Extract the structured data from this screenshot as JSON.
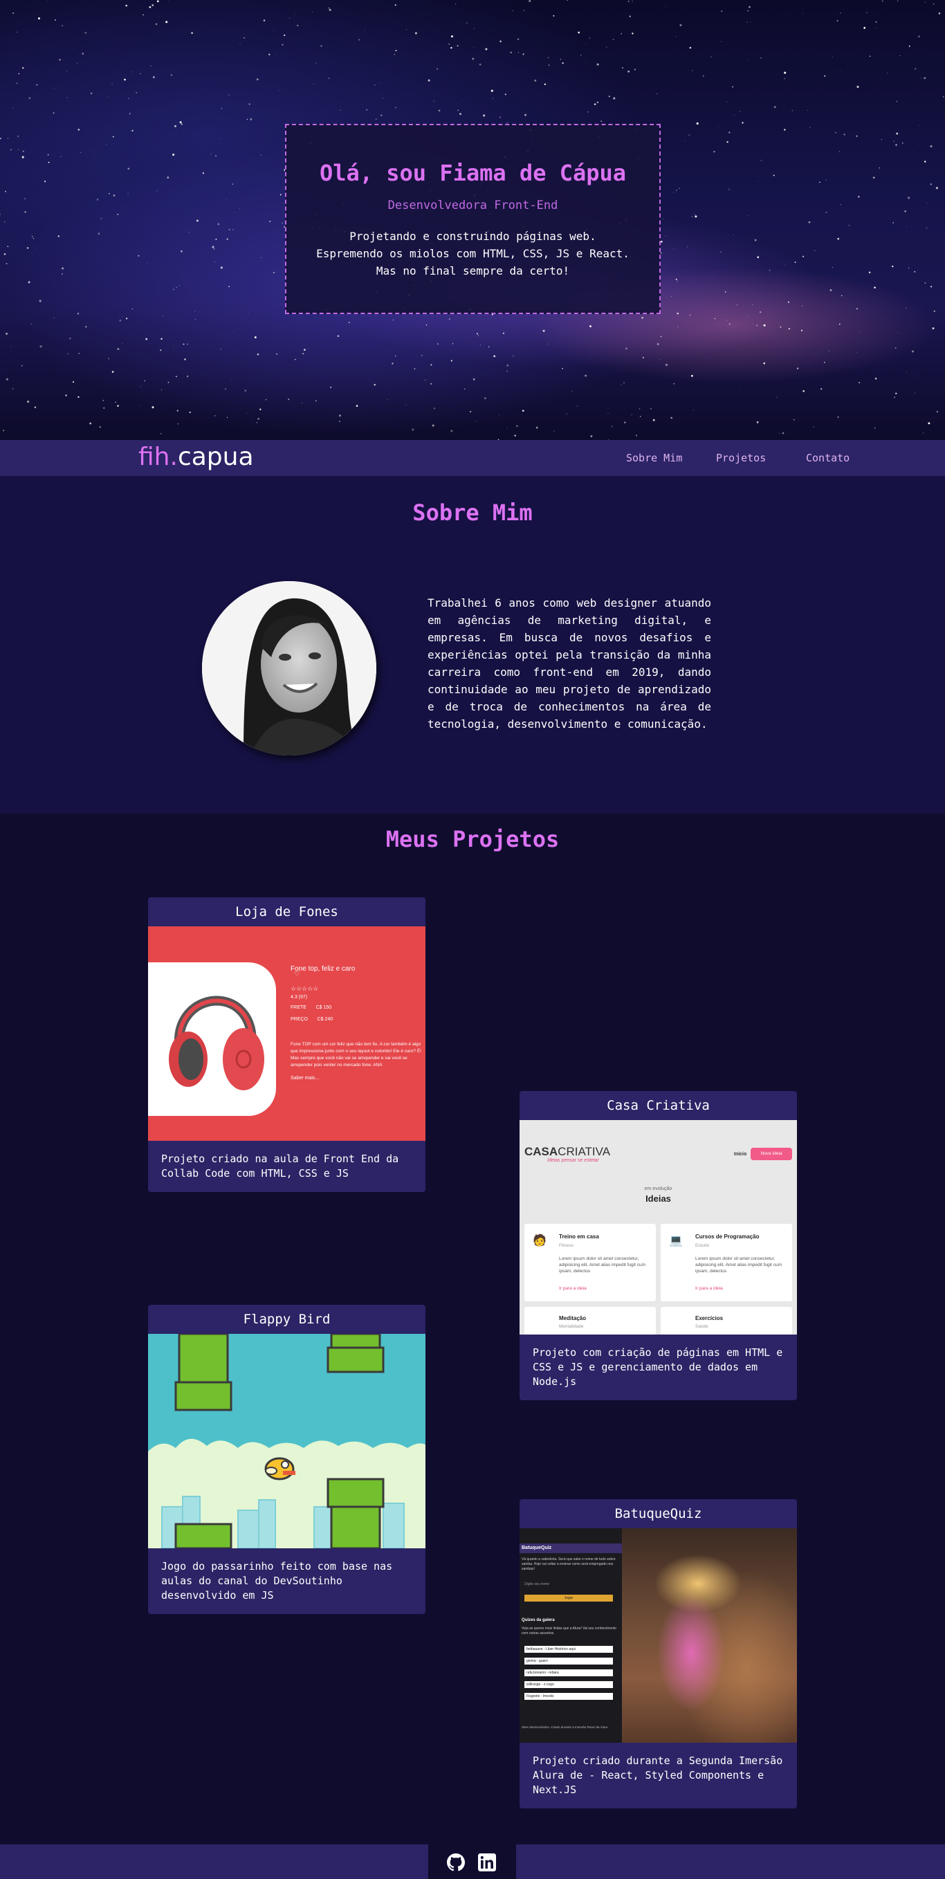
{
  "hero": {
    "title": "Olá, sou Fiama de Cápua",
    "subtitle": "Desenvolvedora Front-End",
    "lines": [
      "Projetando e construindo páginas web.",
      "Espremendo os miolos com HTML, CSS, JS e React.",
      "Mas no final sempre da certo!"
    ]
  },
  "nav": {
    "logo_part1": "fih.",
    "logo_part2": "capua",
    "links": [
      "Sobre Mim",
      "Projetos",
      "Contato"
    ]
  },
  "about": {
    "title": "Sobre Mim",
    "text": "Trabalhei 6 anos como web designer atuando em agências de marketing digital, e empresas. Em busca de novos desafios e experiências optei pela transição da minha carreira como front-end em 2019, dando continuidade ao meu projeto de aprendizado e de troca de conhecimentos na área de tecnologia, desenvolvimento e comunicação."
  },
  "projects": {
    "title": "Meus Projetos",
    "items": [
      {
        "title": "Loja de Fones",
        "description": "Projeto criado na aula de Front End da Collab Code com HTML, CSS e JS",
        "preview": {
          "product": "Fone top, feliz e caro",
          "rating": "4.3 (97)",
          "frete_label": "FRETE",
          "frete_value": "C$ 150",
          "preco_label": "PREÇO",
          "preco_value": "C$ 240",
          "body": "Fone TOP com um cor feliz que não tem fiu. A cor também é algo que impressiona junto com o seu layout e colorido! Ele é caro? É! Mas sempre que você não vai se arrepender e vai você se arrepender pois venter no mercado fone. ANA",
          "more": "Saber mais..."
        }
      },
      {
        "title": "Casa Criativa",
        "description": "Projeto com criação de páginas em HTML e CSS e JS e gerenciamento de dados em Node.js",
        "preview": {
          "brand1": "CASA",
          "brand2": "CRIATIVA",
          "tagline": "Ideias pensar se estetar",
          "nav_link": "Início",
          "nav_button": "Nova Ideia",
          "kicker": "em evolução",
          "heading": "Ideias",
          "cards": [
            {
              "title": "Treino em casa",
              "category": "Fitness",
              "body": "Lorem ipsum dolor sit amet consectetur, adipisicing elit. Amet alias impedit fugit cum ipsam, delectus",
              "link": "Ir para a ideia"
            },
            {
              "title": "Cursos de Programação",
              "category": "Estudo",
              "body": "Lorem ipsum dolor sit amet consectetur, adipisicing elit. Amet alias impedit fugit cum ipsam, delectus",
              "link": "Ir para a ideia"
            },
            {
              "title": "Meditação",
              "category": "Mentalidade"
            },
            {
              "title": "Exercícios",
              "category": "Saúde"
            }
          ]
        }
      },
      {
        "title": "Flappy Bird",
        "description": "Jogo do passarinho feito com base nas aulas do canal do DevSoutinho desenvolvido em JS"
      },
      {
        "title": "BatuqueQuiz",
        "description": "Projeto criado durante a Segunda Imersão Alura de - React, Styled Components e Next.JS",
        "preview": {
          "panel_title": "BatuqueQuiz",
          "intro": "Vá quanto a sabedoria. Será que sabe o nome de tudo sobre samba. Hoje vai voltar a ensinar como será empregado nos sambas!",
          "input_placeholder": "Digite seu nome",
          "button": "Jogar",
          "section_title": "Quizes da galera",
          "section_body": "Veja as quizes mais lindas que a Alura! Vai seu conhecimento com outras assuntos.",
          "list": [
            "betbauane - Liber Histórico aqui",
            "gioma - guaro",
            "rafa.bonanni - rebara",
            "willcosgo - o cogo",
            "Fiagnoto - lmostis"
          ],
          "footer": "Sites desenvolvidos. Criado durante a Imersão React da Alura"
        }
      }
    ]
  },
  "colors": {
    "accent": "#dc72f2",
    "accent_muted": "#c26be3",
    "nav_bg": "#2c2466",
    "page_bg": "#0f0c2e",
    "about_bg": "#151143"
  },
  "footer": {
    "icons": [
      "github-icon",
      "linkedin-icon"
    ]
  }
}
